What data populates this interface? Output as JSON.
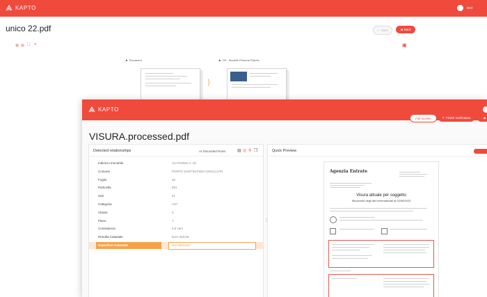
{
  "back_window": {
    "logo_text": "KAPTO",
    "user_label": "test",
    "file_title": "unico 22.pdf",
    "save_label": "Save",
    "back_label": "Back",
    "zoom_tools": [
      "zoom-in-icon",
      "zoom-out-icon",
      "fullscreen-icon",
      "expand-icon"
    ],
    "doc_cards": [
      {
        "label": "Document"
      },
      {
        "label": "OS - Modello Persone Fisiche"
      }
    ]
  },
  "front_window": {
    "logo_text": "KAPTO",
    "file_title": "VISURA.processed.pdf",
    "full_screen_label": "Full Screen",
    "finish_verification_label": "Finish Verification",
    "detected_relationships_title": "Detected relationships",
    "discarded_rows_label": "AI Discarded Rows",
    "quick_preview_title": "Quick Preview",
    "rows": [
      {
        "key": "Indirizzo Immobile",
        "value": "VIA PARMA n. 20"
      },
      {
        "key": "Comune",
        "value": "PORTO SANT'ELPIDIO (G921) (AP)"
      },
      {
        "key": "Foglio",
        "value": "20"
      },
      {
        "key": "Particella",
        "value": "561"
      },
      {
        "key": "Sub",
        "value": "21"
      },
      {
        "key": "Categoria",
        "value": "A/2*"
      },
      {
        "key": "Classe",
        "value": "3"
      },
      {
        "key": "Piano",
        "value": "7"
      },
      {
        "key": "Consistenza",
        "value": "5,5 vani"
      },
      {
        "key": "Rendita Catastale",
        "value": "Euro 353,05"
      },
      {
        "key": "Superficie Catastale",
        "value": "Not detected"
      }
    ],
    "preview": {
      "agency": "Agenzia Entrate",
      "heading": "Visura attuale per soggetto",
      "subheading": "Situazione degli atti informatizzati al 02/06/2023"
    }
  },
  "colors": {
    "accent": "#f04a3d",
    "highlight": "#f7a24a"
  }
}
